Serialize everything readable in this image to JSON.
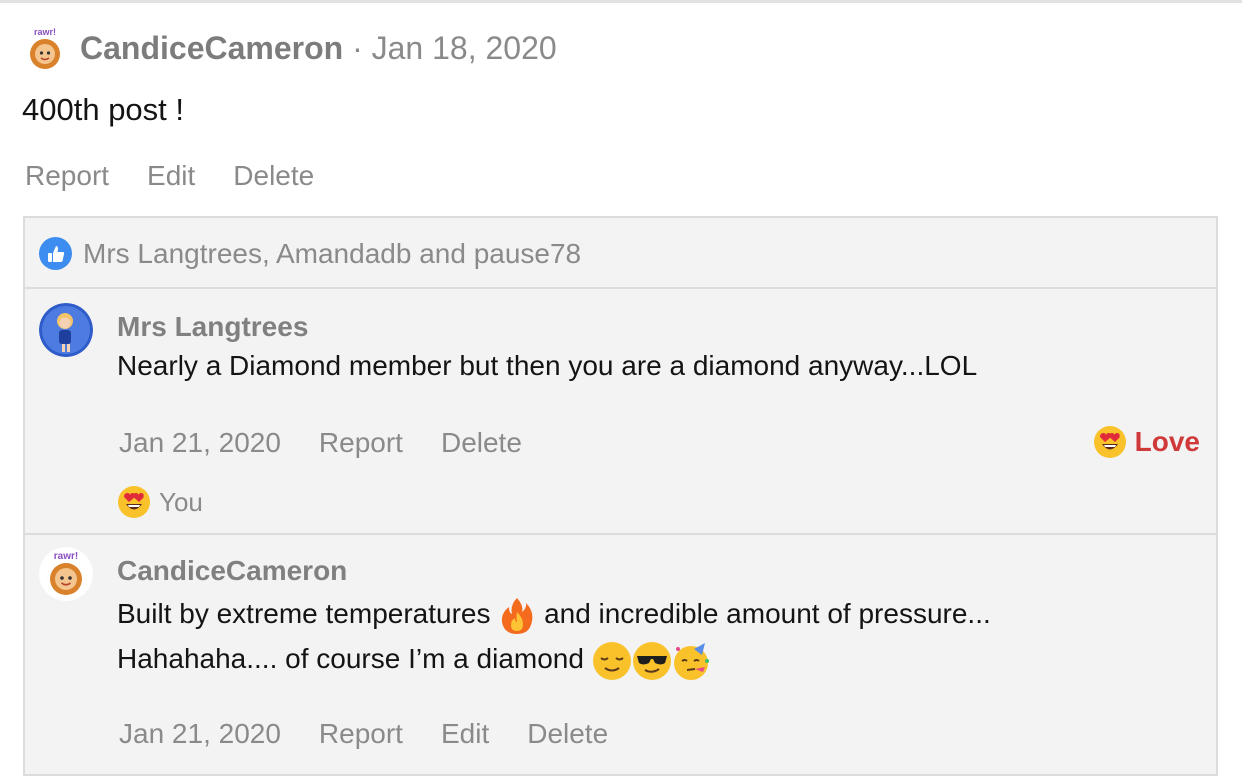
{
  "post": {
    "author": "CandiceCameron",
    "separator": " · ",
    "date": "Jan 18, 2020",
    "avatar_badge": "rawr!",
    "body": "400th post !",
    "actions": {
      "report": "Report",
      "edit": "Edit",
      "delete": "Delete"
    }
  },
  "likes": {
    "icon": "thumbs-up-icon",
    "text": "Mrs Langtrees, Amandadb and pause78"
  },
  "comments": [
    {
      "author": "Mrs Langtrees",
      "text": "Nearly a Diamond member but then you are a diamond anyway...LOL",
      "date": "Jan 21, 2020",
      "actions": {
        "report": "Report",
        "delete": "Delete"
      },
      "reaction_button": {
        "icon": "heart-eyes-emoji",
        "label": "Love",
        "color": "#d0393a"
      },
      "reaction_summary": {
        "icon": "heart-eyes-emoji",
        "label": "You"
      }
    },
    {
      "author": "CandiceCameron",
      "avatar_badge": "rawr!",
      "line1": "Built by extreme temperatures",
      "line1_rest": "and incredible amount of pressure...",
      "line2": "Hahahaha.... of course I’m a diamond",
      "date": "Jan 21, 2020",
      "actions": {
        "report": "Report",
        "edit": "Edit",
        "delete": "Delete"
      }
    }
  ],
  "colors": {
    "muted_text": "#8a8a8a",
    "block_bg": "#f3f3f3",
    "love": "#d0393a",
    "like_blue": "#3d8df0"
  }
}
